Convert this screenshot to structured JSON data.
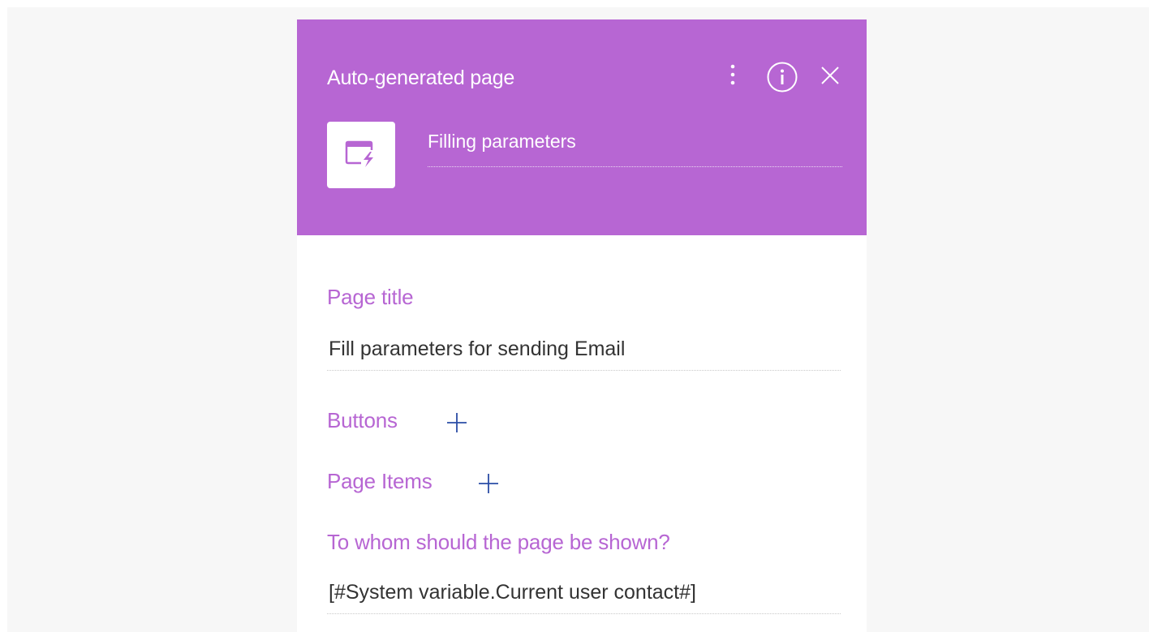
{
  "header": {
    "title": "Auto-generated page",
    "element_name": "Filling parameters",
    "accent_color": "#b766d3"
  },
  "icons": {
    "menu": "kebab-menu-icon",
    "info": "info-icon",
    "close": "close-icon",
    "element": "auto-generated-page-icon",
    "add": "plus-icon"
  },
  "page_title": {
    "label": "Page title",
    "value": "Fill parameters for sending Email"
  },
  "buttons": {
    "label": "Buttons"
  },
  "page_items": {
    "label": "Page Items"
  },
  "recipient": {
    "label": "To whom should the page be shown?",
    "value": "[#System variable.Current user contact#]"
  }
}
